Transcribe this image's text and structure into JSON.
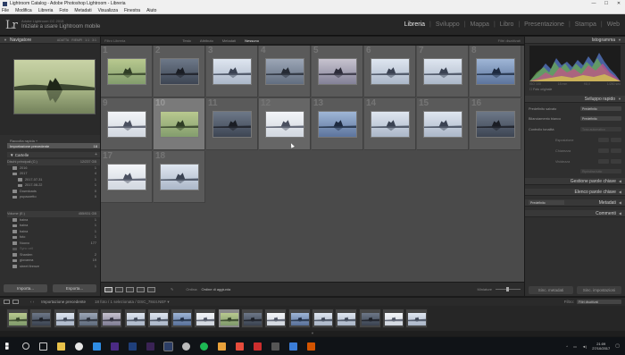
{
  "window": {
    "title": "Lightroom Catalog - Adobe Photoshop Lightroom - Libreria",
    "controls": [
      "—",
      "☐",
      "✕"
    ]
  },
  "menu": [
    "File",
    "Modifica",
    "Libreria",
    "Foto",
    "Metadati",
    "Visualizza",
    "Finestra",
    "Aiuto"
  ],
  "identity": {
    "logo": "Lr",
    "product": "Adobe Lightroom CC 2015",
    "headline": "Iniziate a usare Lightroom mobile"
  },
  "modules": [
    "Libreria",
    "Sviluppo",
    "Mappa",
    "Libro",
    "Presentazione",
    "Stampa",
    "Web"
  ],
  "active_module": "Libreria",
  "left": {
    "navigator_title": "Navigatore",
    "navigator_options": [
      "ADATTA",
      "RIEMPI",
      "1:1",
      "3:1"
    ],
    "catalog": [
      {
        "label": "Raccolta rapida +",
        "count": ""
      },
      {
        "label": "Importazione precedente",
        "count": "18"
      }
    ],
    "folders_title": "Cartelle",
    "volume1": {
      "label": "Dischi principali (C:)",
      "info": "12/237 GB"
    },
    "volume1_tree": [
      {
        "label": "2016",
        "count": "1"
      },
      {
        "label": "2017",
        "count": "4"
      },
      {
        "label": "2017-07-31",
        "count": "1"
      },
      {
        "label": "2017-08-22",
        "count": "1"
      },
      {
        "label": "Downloads",
        "count": "0"
      },
      {
        "label": "pupazzetto",
        "count": "0"
      }
    ],
    "volume2": {
      "label": "Volume (E:)",
      "info": "455/931 GB"
    },
    "volume2_tree": [
      {
        "label": "baina",
        "count": "1"
      },
      {
        "label": "baina",
        "count": "1"
      },
      {
        "label": "baina",
        "count": "1"
      },
      {
        "label": "foto",
        "count": "1"
      },
      {
        "label": "Nuovo",
        "count": "177"
      },
      {
        "label": "Sync cell",
        "count": ""
      },
      {
        "label": "Sharden",
        "count": "2"
      },
      {
        "label": "giovanna",
        "count": "19"
      },
      {
        "label": "street firenze",
        "count": "1"
      }
    ],
    "import_button": "Importa...",
    "export_button": "Esporta..."
  },
  "center": {
    "filter_label": "Filtro Libreria",
    "filter_tabs": [
      "Testo",
      "Attributo",
      "Metadati",
      "Nessuno"
    ],
    "active_filter": "Nessuno",
    "filter_right": "Filtri disattivati",
    "cells": [
      {
        "num": "1",
        "tone": "green"
      },
      {
        "num": "2",
        "tone": "dark"
      },
      {
        "num": "3",
        "tone": "pale"
      },
      {
        "num": "4",
        "tone": "mid"
      },
      {
        "num": "5",
        "tone": "dusk"
      },
      {
        "num": "6",
        "tone": "pale"
      },
      {
        "num": "7",
        "tone": "pale"
      },
      {
        "num": "8",
        "tone": "blue"
      },
      {
        "num": "9",
        "tone": "white"
      },
      {
        "num": "10",
        "tone": "green"
      },
      {
        "num": "11",
        "tone": "dark"
      },
      {
        "num": "12",
        "tone": "white"
      },
      {
        "num": "13",
        "tone": "blue"
      },
      {
        "num": "14",
        "tone": "pale"
      },
      {
        "num": "15",
        "tone": "pale"
      },
      {
        "num": "16",
        "tone": "dark"
      },
      {
        "num": "17",
        "tone": "white"
      },
      {
        "num": "18",
        "tone": "pale"
      }
    ],
    "selected_index": 9,
    "toolbar": {
      "ordina_label": "Ordina:",
      "ordina_value": "Ordine di aggiunta",
      "miniature_label": "Miniature"
    }
  },
  "right": {
    "histogram_title": "Istogramma",
    "hist_meta": [
      "ISO 100",
      "18 mm",
      "f/8,0",
      "1/250 sec"
    ],
    "original_photo": "Foto originale",
    "quick_develop_title": "Sviluppo rapido",
    "saved_preset_label": "Predefinito salvato",
    "saved_preset_value": "Predefinito",
    "white_balance_label": "Bilanciamento bianco",
    "white_balance_value": "Predefinito",
    "tone_control_label": "Controllo tonalità",
    "tone_control_value": "Tono automatico",
    "exposure_label": "Esposizione",
    "clarity_label": "Chiarezza",
    "vibrance_label": "Vividezza",
    "reset_label": "Ripristina tutto",
    "keywording_title": "Gestione parole chiave",
    "keyword_list_title": "Elenco parole chiave",
    "metadata_label": "Predefinito",
    "metadata_title": "Metadati",
    "comments_title": "Commenti",
    "sync_metadata": "Sinc. metadati",
    "sync_settings": "Sinc. impostazioni"
  },
  "filmbar": {
    "source": "Importazione precedente",
    "info": "18 foto / 1 selezionata / DSC_7844.NEF ▾",
    "filter_label": "Filtro:",
    "filter_value": "Filtri disattivati"
  },
  "filmstrip_tones": [
    "green",
    "dark",
    "pale",
    "mid",
    "dusk",
    "pale",
    "pale",
    "blue",
    "white",
    "green",
    "dark",
    "white",
    "blue",
    "pale",
    "pale",
    "dark",
    "white",
    "pale"
  ],
  "clock": {
    "time": "21:09",
    "date": "27/10/2017"
  },
  "colors": {
    "panel_bg": "#2f2f2f",
    "grid_bg": "#4a4a4a",
    "selected_cell": "#7a7a7a",
    "active_module": "#e8e8e8"
  }
}
